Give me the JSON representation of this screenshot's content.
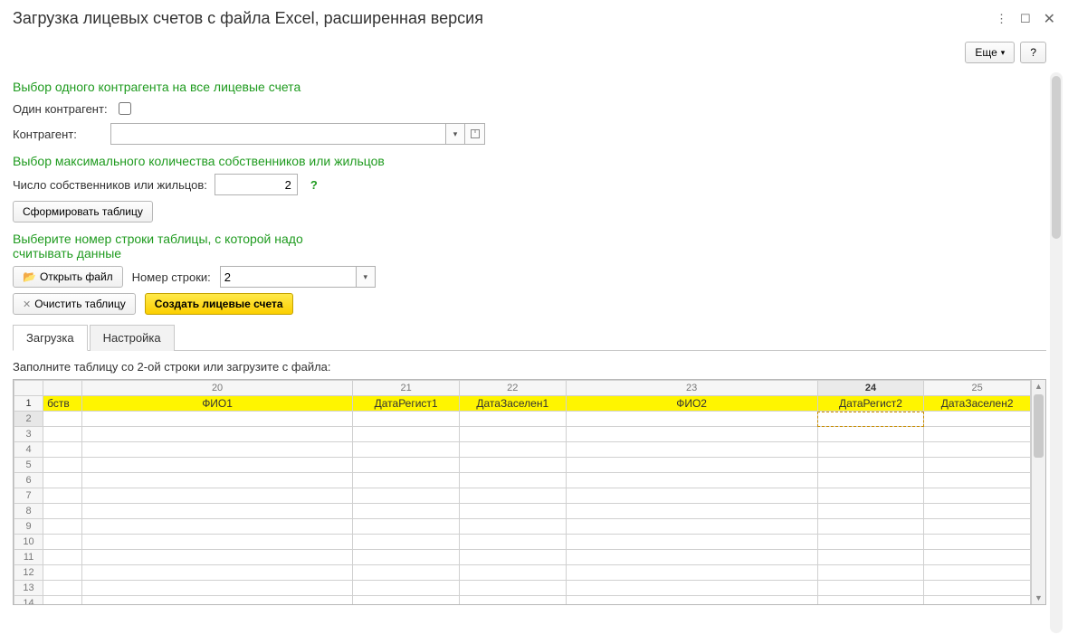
{
  "window_title": "Загрузка лицевых счетов с файла Excel, расширенная версия",
  "buttons": {
    "more": "Еще",
    "help": "?",
    "form_table": "Сформировать таблицу",
    "open_file": "Открыть файл",
    "clear_table": "Очистить таблицу",
    "create_accounts": "Создать лицевые счета"
  },
  "sections": {
    "s1": "Выбор одного контрагента на все лицевые счета",
    "s2": "Выбор максимального количества собственников или жильцов",
    "s3": "Выберите номер строки таблицы, с которой надо считывать данные"
  },
  "labels": {
    "one_counterparty": "Один контрагент:",
    "counterparty": "Контрагент:",
    "owner_count": "Число собственников или жильцов:",
    "row_number": "Номер строки:"
  },
  "values": {
    "counterparty": "",
    "owner_count": "2",
    "row_number": "2"
  },
  "tabs": {
    "t1": "Загрузка",
    "t2": "Настройка"
  },
  "hint": "Заполните таблицу со 2-ой строки или загрузите с файла:",
  "sheet": {
    "col_numbers": [
      "20",
      "21",
      "22",
      "23",
      "24",
      "25"
    ],
    "header_row": [
      "бств",
      "ФИО1",
      "ДатаРегист1",
      "ДатаЗаселен1",
      "ФИО2",
      "ДатаРегист2",
      "ДатаЗаселен2"
    ],
    "rows": [
      "1",
      "2",
      "3",
      "4",
      "5",
      "6",
      "7",
      "8",
      "9",
      "10",
      "11",
      "12",
      "13",
      "14"
    ],
    "selected_row": "2",
    "selected_col_index": 5,
    "active_col_header": "24"
  }
}
